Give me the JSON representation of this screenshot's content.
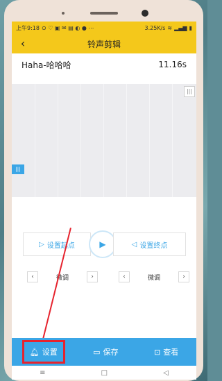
{
  "statusbar": {
    "time": "上午9:18",
    "network_speed": "3.25K/s",
    "battery": "▮"
  },
  "appbar": {
    "title": "铃声剪辑"
  },
  "file": {
    "name": "Haha-哈哈哈",
    "duration": "11.16s"
  },
  "controls": {
    "set_start": "设置起点",
    "set_end": "设置终点",
    "fine_left": "微调",
    "fine_right": "微调"
  },
  "bottom": {
    "settings": "设置",
    "save": "保存",
    "view": "查看"
  }
}
